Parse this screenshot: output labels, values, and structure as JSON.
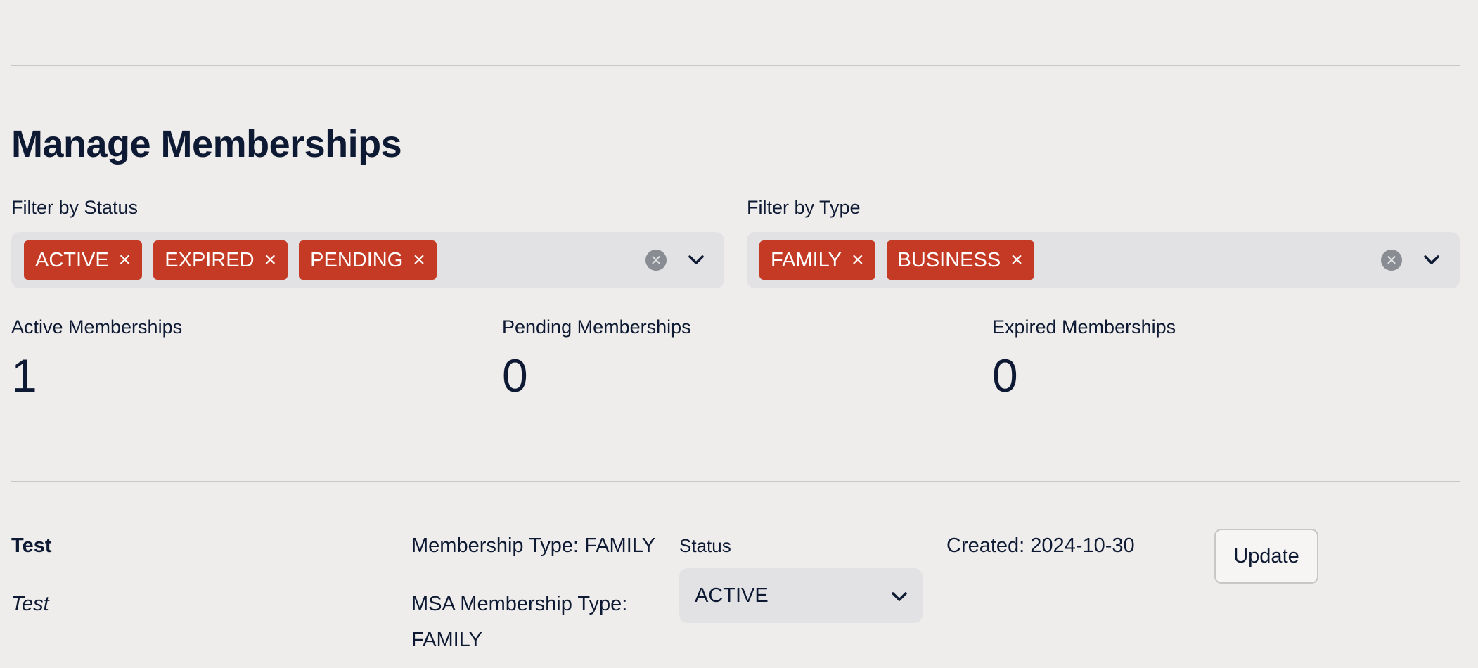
{
  "page": {
    "title": "Manage Memberships"
  },
  "filters": {
    "status": {
      "label": "Filter by Status",
      "chips": [
        "ACTIVE",
        "EXPIRED",
        "PENDING"
      ]
    },
    "type": {
      "label": "Filter by Type",
      "chips": [
        "FAMILY",
        "BUSINESS"
      ]
    },
    "chip_remove_glyph": "×",
    "clear_glyph": "✕"
  },
  "metrics": [
    {
      "label": "Active Memberships",
      "value": "1"
    },
    {
      "label": "Pending Memberships",
      "value": "0"
    },
    {
      "label": "Expired Memberships",
      "value": "0"
    }
  ],
  "membership_row": {
    "name": "Test",
    "description": "Test",
    "membership_type": "Membership Type: FAMILY",
    "msa_type_line1": "MSA Membership Type:",
    "msa_type_line2": "FAMILY",
    "status_label": "Status",
    "status_value": "ACTIVE",
    "created": "Created: 2024-10-30",
    "update_label": "Update"
  },
  "colors": {
    "background": "#efedeb",
    "text": "#0e1a33",
    "chip": "#c43a24",
    "input_bg": "#e2e2e5",
    "divider": "#c9c7c5"
  },
  "icons": {
    "clear": "clear-circle-icon",
    "dropdown": "chevron-down-icon",
    "remove": "close-icon"
  }
}
